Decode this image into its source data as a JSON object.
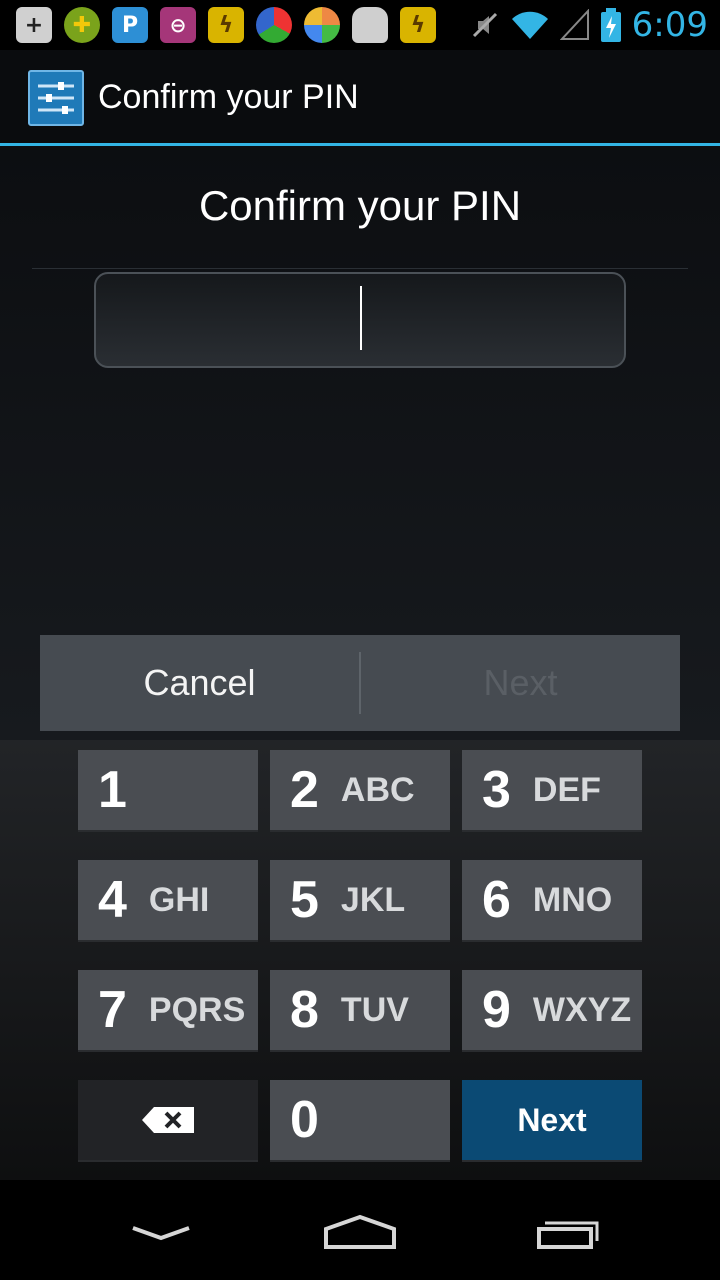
{
  "status_bar": {
    "time": "6:09",
    "notification_icons": [
      "add-icon",
      "game-icon",
      "p-app-icon",
      "back-circle-icon",
      "bird-app-icon",
      "chrome-like-icon",
      "ball-icon",
      "android-icon",
      "bird-app-icon"
    ],
    "system_icons": [
      "mute-icon",
      "wifi-icon",
      "signal-icon",
      "battery-charging-icon"
    ],
    "accent_color": "#33b5e5"
  },
  "action_bar": {
    "title": "Confirm your PIN",
    "icon": "settings-icon"
  },
  "content": {
    "header": "Confirm your PIN",
    "pin_value": "",
    "buttons": {
      "cancel": "Cancel",
      "next": "Next"
    }
  },
  "keypad": {
    "keys": [
      {
        "num": "1",
        "letters": ""
      },
      {
        "num": "2",
        "letters": "ABC"
      },
      {
        "num": "3",
        "letters": "DEF"
      },
      {
        "num": "4",
        "letters": "GHI"
      },
      {
        "num": "5",
        "letters": "JKL"
      },
      {
        "num": "6",
        "letters": "MNO"
      },
      {
        "num": "7",
        "letters": "PQRS"
      },
      {
        "num": "8",
        "letters": "TUV"
      },
      {
        "num": "9",
        "letters": "WXYZ"
      },
      {
        "num": "0",
        "letters": ""
      }
    ],
    "delete_icon": "backspace-icon",
    "next_label": "Next",
    "next_color": "#0b4a74"
  },
  "nav_bar": {
    "buttons": [
      "back-icon",
      "home-icon",
      "recents-icon"
    ]
  }
}
